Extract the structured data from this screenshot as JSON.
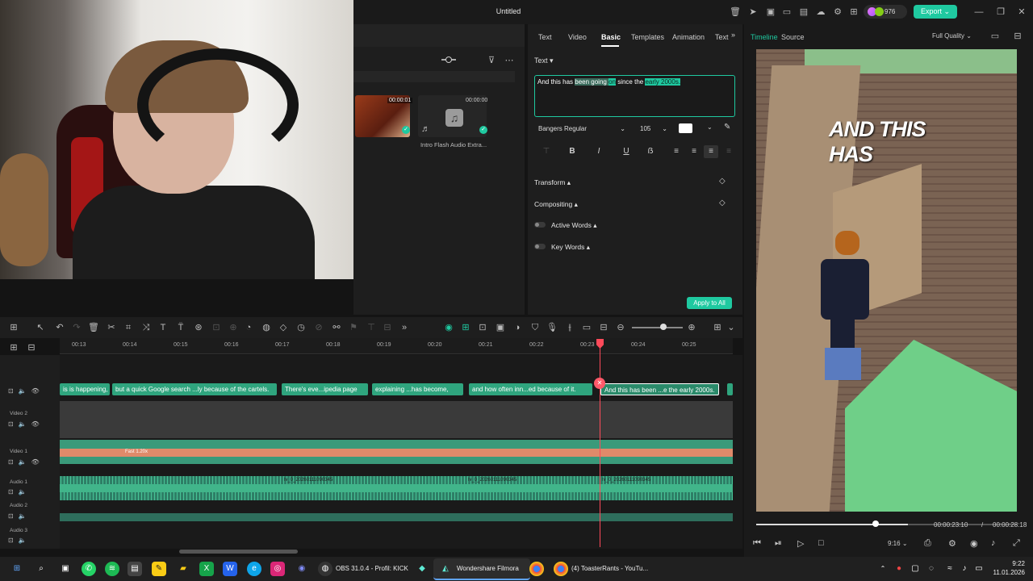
{
  "titlebar": {
    "title": "Untitled",
    "credits": "976",
    "export_label": "Export"
  },
  "media": {
    "thumb1_duration": "00:00:01",
    "thumb2_duration": "00:00:00",
    "thumb2_label": "Intro Flash Audio Extra..."
  },
  "props": {
    "tabs": [
      "Text",
      "Video",
      "Basic",
      "Templates",
      "Animation",
      "Text"
    ],
    "active_tab": "Basic",
    "section_label": "Text",
    "text_parts": [
      "And this has ",
      "been going ",
      "on",
      " since the ",
      "early",
      " ",
      "2000s."
    ],
    "font": "Bangers Regular",
    "size": "105",
    "color": "#ffffff",
    "sections": [
      "Transform",
      "Compositing",
      "Active Words",
      "Key Words"
    ],
    "apply_label": "Apply to All"
  },
  "preview": {
    "tab_timeline": "Timeline",
    "tab_source": "Source",
    "quality": "Full Quality",
    "caption": "AND THIS HAS",
    "current_time": "00:00:23:10",
    "separator": "/",
    "total_time": "00:00:28:18",
    "aspect": "9:16",
    "progress": 0.82
  },
  "timeline": {
    "ruler": [
      "00:13",
      "00:14",
      "00:15",
      "00:16",
      "00:17",
      "00:18",
      "00:19",
      "00:20",
      "00:21",
      "00:22",
      "00:23",
      "00:24",
      "00:25"
    ],
    "tracks": [
      "Video 2",
      "Video 1",
      "Audio 1",
      "Audio 2",
      "Audio 3"
    ],
    "text_clips": [
      "is is happening,",
      "but a quick Google search ...ly because of the cartels.",
      "There's eve...ipedia page",
      "explaining ...has become,",
      "and how often inn...ed because of it.",
      "And this has been ...e the early 2000s."
    ],
    "speed_label": "Fast 1.20x",
    "audio_labels": [
      "lv_0_20260111090345",
      "lv_0_20260111090345",
      "lv_0_20260111090345"
    ]
  },
  "taskbar": {
    "obs_label": "OBS 31.0.4 - Profil: KICK",
    "filmora_label": "Wondershare Filmora",
    "chrome_label": "(4) ToasterRants - YouTu...",
    "time": "9:22",
    "date": "11.01.2026"
  },
  "colors": {
    "accent": "#1fc9a0",
    "playhead": "#ff4a5a"
  }
}
